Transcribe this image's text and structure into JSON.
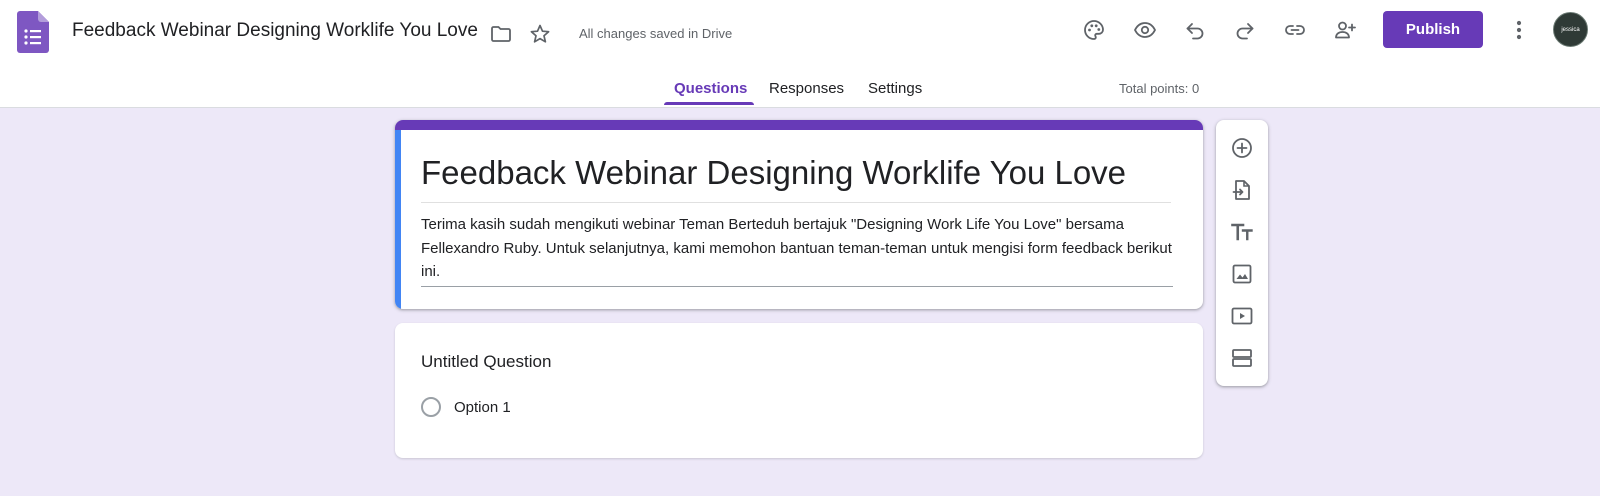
{
  "header": {
    "doc_title": "Feedback Webinar Designing Worklife You Love",
    "save_status": "All changes saved in Drive",
    "publish_label": "Publish",
    "avatar_text": "jessica",
    "accent_color": "#673ab7"
  },
  "header_icons": [
    "palette-icon",
    "eye-icon",
    "undo-icon",
    "redo-icon",
    "link-icon",
    "add-person-icon",
    "more-vert-icon"
  ],
  "tabs": [
    {
      "label": "Questions",
      "active": true
    },
    {
      "label": "Responses",
      "active": false
    },
    {
      "label": "Settings",
      "active": false
    }
  ],
  "total_points": "Total points: 0",
  "form": {
    "title": "Feedback Webinar Designing Worklife You Love",
    "description": "Terima kasih sudah mengikuti webinar Teman Berteduh bertajuk \"Designing Work Life You Love\" bersama Fellexandro Ruby. Untuk selanjutnya, kami memohon bantuan teman-teman untuk mengisi form feedback berikut ini."
  },
  "question": {
    "title": "Untitled Question",
    "options": [
      "Option 1"
    ]
  },
  "side_toolbar": [
    "add-question-icon",
    "import-questions-icon",
    "add-title-icon",
    "add-image-icon",
    "add-video-icon",
    "add-section-icon"
  ]
}
